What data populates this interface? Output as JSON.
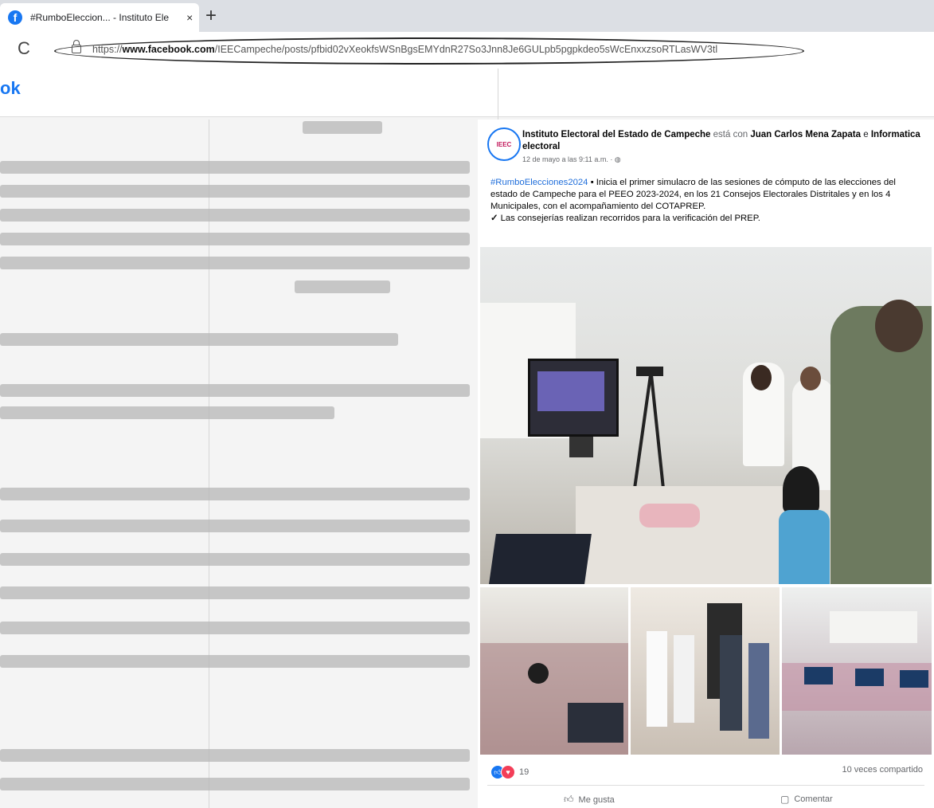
{
  "browser": {
    "tab_title": "#RumboEleccion... - Instituto Ele",
    "close_glyph": "×",
    "new_tab_glyph": "+",
    "reload_glyph": "C",
    "url_prefix": "https://",
    "url_domain": "www.facebook.com",
    "url_path": "/IEECampeche/posts/pfbid02vXeokfsWSnBgsEMYdnR27So3Jnn8Je6GULpb5pgpkdeo5sWcEnxxzsoRTLasWV3tl"
  },
  "facebook": {
    "logo_text": "ok",
    "brand_color": "#1877f2"
  },
  "post": {
    "avatar_text": "IEEC",
    "author": "Instituto Electoral del Estado de Campeche",
    "with_text": "está con",
    "tagged_1": "Juan Carlos Mena Zapata",
    "and_text": "e",
    "tagged_2": "Informatica electoral",
    "date": "12 de mayo a las 9:11 a.m. · ",
    "hashtag": "#RumboElecciones2024",
    "body": "Inicia el primer simulacro de las sesiones de cómputo de las elecciones del estado de Campeche para el PEEO 2023-2024, en los 21 Consejos Electorales Distritales y en los 4 Municipales, con el acompañamiento del COTAPREP.",
    "check_glyph": "✓",
    "body_line2": "Las consejerías realizan recorridos para la verificación del PREP.",
    "reaction_count": "19",
    "shares_text": "10 veces compartido",
    "like_label": "Me gusta",
    "comment_label": "Comentar",
    "like_icon": "thumbs-up-icon",
    "comment_icon": "speech-bubble-icon"
  }
}
